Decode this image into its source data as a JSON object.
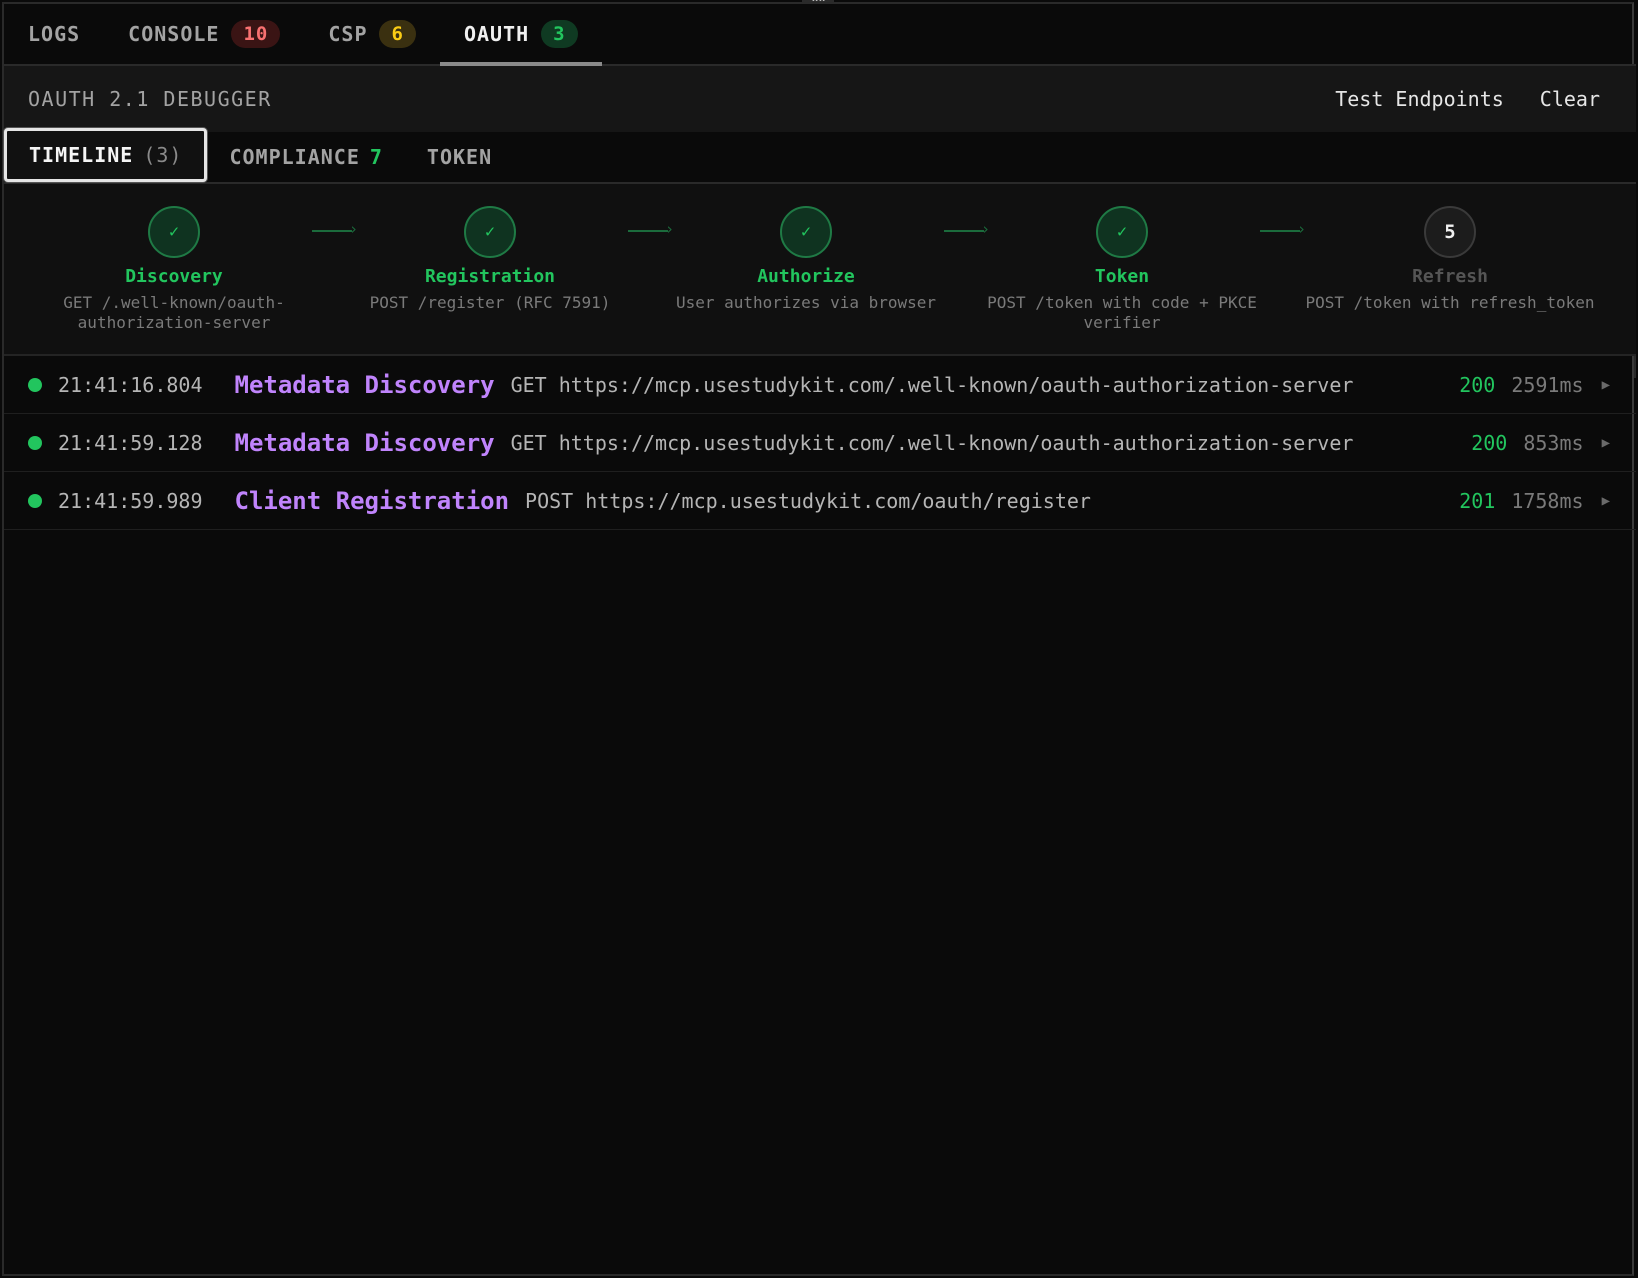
{
  "top_tabs": [
    {
      "label": "LOGS",
      "badge": ""
    },
    {
      "label": "CONSOLE",
      "badge": "10"
    },
    {
      "label": "CSP",
      "badge": "6"
    },
    {
      "label": "OAUTH",
      "badge": "3"
    }
  ],
  "debugger": {
    "title": "OAUTH 2.1 DEBUGGER",
    "test_endpoints_label": "Test Endpoints",
    "clear_label": "Clear"
  },
  "sub_tabs": {
    "timeline": {
      "label": "TIMELINE",
      "count": "(3)"
    },
    "compliance": {
      "label": "COMPLIANCE",
      "count": "7"
    },
    "token": {
      "label": "TOKEN"
    }
  },
  "flow": {
    "steps": [
      {
        "icon": "✓",
        "name": "Discovery",
        "desc": "GET /.well-known/oauth-authorization-server",
        "state": "done"
      },
      {
        "icon": "✓",
        "name": "Registration",
        "desc": "POST /register (RFC 7591)",
        "state": "done"
      },
      {
        "icon": "✓",
        "name": "Authorize",
        "desc": "User authorizes via browser",
        "state": "done"
      },
      {
        "icon": "✓",
        "name": "Token",
        "desc": "POST /token with code + PKCE verifier",
        "state": "done"
      },
      {
        "icon": "5",
        "name": "Refresh",
        "desc": "POST /token with refresh_token",
        "state": "pending"
      }
    ]
  },
  "rows": [
    {
      "time": "21:41:16.804",
      "label": "Metadata Discovery",
      "method": "GET",
      "url": "https://mcp.usestudykit.com/.well-known/oauth-authorization-server",
      "status": "200",
      "duration": "2591ms"
    },
    {
      "time": "21:41:59.128",
      "label": "Metadata Discovery",
      "method": "GET",
      "url": "https://mcp.usestudykit.com/.well-known/oauth-authorization-server",
      "status": "200",
      "duration": "853ms"
    },
    {
      "time": "21:41:59.989",
      "label": "Client Registration",
      "method": "POST",
      "url": "https://mcp.usestudykit.com/oauth/register",
      "status": "201",
      "duration": "1758ms"
    }
  ],
  "colors": {
    "accent_green": "#22c55e",
    "accent_purple": "#c084fc",
    "badge_red": "#f87171",
    "badge_yellow": "#facc15"
  }
}
